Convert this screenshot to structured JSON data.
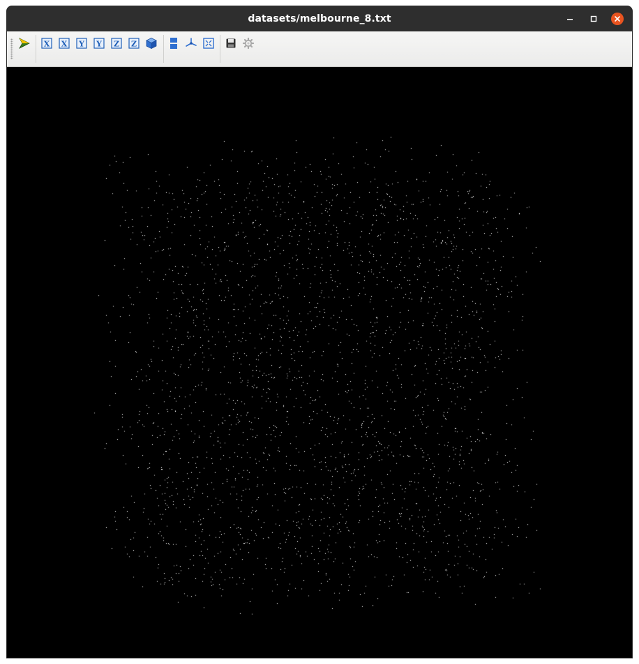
{
  "window": {
    "title": "datasets/melbourne_8.txt"
  },
  "titlebar_controls": [
    {
      "name": "minimize",
      "glyph": "–"
    },
    {
      "name": "maximize",
      "glyph": "□"
    },
    {
      "name": "close",
      "glyph": "×"
    }
  ],
  "toolbar": {
    "buttons": [
      {
        "icon": "select-arrow-icon"
      },
      {
        "icon": "front-view-x-icon",
        "glyph": "X"
      },
      {
        "icon": "back-view-x-icon",
        "glyph": "X"
      },
      {
        "icon": "front-view-y-icon",
        "glyph": "Y"
      },
      {
        "icon": "back-view-y-icon",
        "glyph": "Y"
      },
      {
        "icon": "front-view-z-icon",
        "glyph": "Z"
      },
      {
        "icon": "back-view-z-icon",
        "glyph": "Z"
      },
      {
        "icon": "isometric-cube-icon"
      },
      {
        "icon": "split-view-icon"
      },
      {
        "icon": "axes-icon"
      },
      {
        "icon": "fit-view-icon"
      },
      {
        "icon": "save-icon"
      },
      {
        "icon": "settings-gear-icon"
      }
    ]
  },
  "colors": {
    "titlebar_bg": "#2e2e2e",
    "close_button": "#e95420",
    "viewport_bg": "#000000",
    "points": "#ffffff",
    "icon_blue": "#1f5fb8"
  },
  "viewport": {
    "content": "point-cloud"
  }
}
